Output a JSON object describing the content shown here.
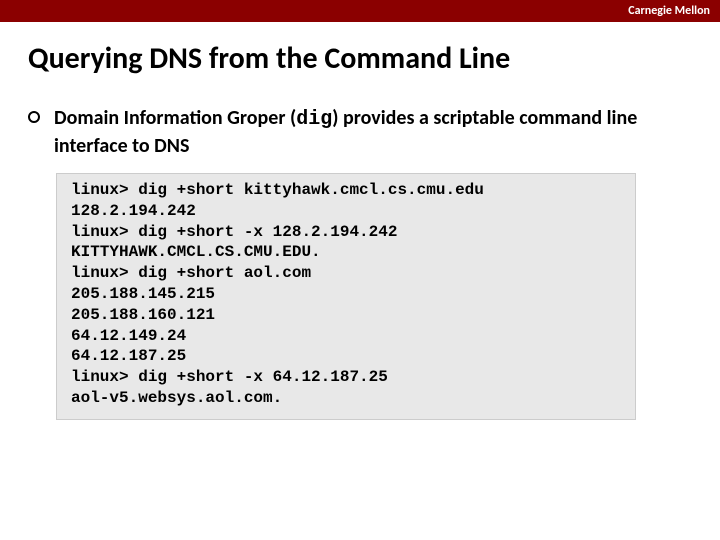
{
  "header": {
    "brand": "Carnegie Mellon"
  },
  "slide": {
    "title": "Querying DNS from the Command Line",
    "bullet": {
      "prefix": "Domain Information Groper (",
      "mono": "dig",
      "suffix": ") provides a scriptable command line interface to DNS"
    },
    "code": [
      "linux> dig +short kittyhawk.cmcl.cs.cmu.edu",
      "128.2.194.242",
      "linux> dig +short -x 128.2.194.242",
      "KITTYHAWK.CMCL.CS.CMU.EDU.",
      "linux> dig +short aol.com",
      "205.188.145.215",
      "205.188.160.121",
      "64.12.149.24",
      "64.12.187.25",
      "linux> dig +short -x 64.12.187.25",
      "aol-v5.websys.aol.com."
    ]
  }
}
